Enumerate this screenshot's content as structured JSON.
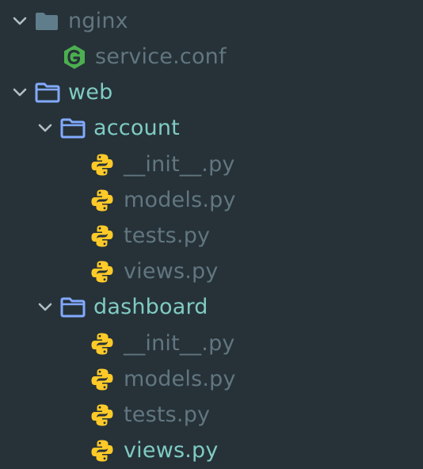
{
  "tree": {
    "nginx": {
      "label": "nginx",
      "icon": "folder-closed-icon",
      "expanded": true
    },
    "service_conf": {
      "label": "service.conf",
      "icon": "nginx-file-icon"
    },
    "web": {
      "label": "web",
      "icon": "folder-open-icon",
      "expanded": true
    },
    "account": {
      "label": "account",
      "icon": "folder-open-icon",
      "expanded": true,
      "files": [
        {
          "label": "__init__.py",
          "icon": "python-icon"
        },
        {
          "label": "models.py",
          "icon": "python-icon"
        },
        {
          "label": "tests.py",
          "icon": "python-icon"
        },
        {
          "label": "views.py",
          "icon": "python-icon"
        }
      ]
    },
    "dashboard": {
      "label": "dashboard",
      "icon": "folder-open-icon",
      "expanded": true,
      "files": [
        {
          "label": "__init__.py",
          "icon": "python-icon"
        },
        {
          "label": "models.py",
          "icon": "python-icon"
        },
        {
          "label": "tests.py",
          "icon": "python-icon"
        },
        {
          "label": "views.py",
          "icon": "python-icon",
          "selected": true
        }
      ]
    }
  },
  "colors": {
    "background": "#263238",
    "dim_text": "#627680",
    "open_folder_text": "#80cbc4",
    "folder_icon_open": "#82aaff",
    "folder_icon_closed": "#607d8b",
    "nginx_icon": "#4caf50",
    "python_icon": "#ffca28"
  }
}
